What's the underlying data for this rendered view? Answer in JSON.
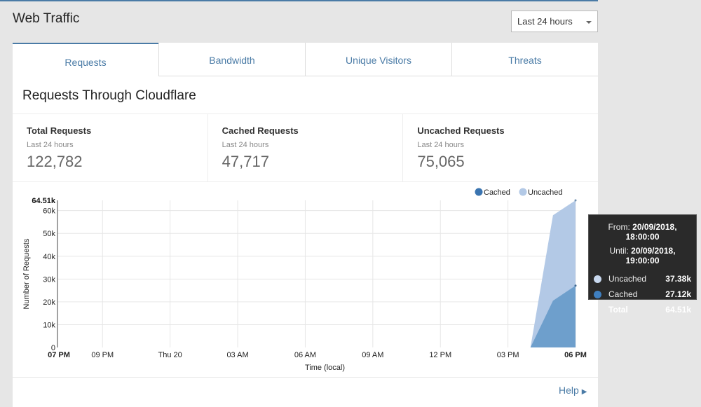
{
  "header": {
    "title": "Web Traffic",
    "range_select": "Last 24 hours"
  },
  "tabs": [
    {
      "label": "Requests"
    },
    {
      "label": "Bandwidth"
    },
    {
      "label": "Unique Visitors"
    },
    {
      "label": "Threats"
    }
  ],
  "section_title": "Requests Through Cloudflare",
  "stats": [
    {
      "label": "Total Requests",
      "sub": "Last 24 hours",
      "value": "122,782"
    },
    {
      "label": "Cached Requests",
      "sub": "Last 24 hours",
      "value": "47,717"
    },
    {
      "label": "Uncached Requests",
      "sub": "Last 24 hours",
      "value": "75,065"
    }
  ],
  "tooltip": {
    "from_label": "From:",
    "from": "20/09/2018, 18:00:00",
    "until_label": "Until:",
    "until": "20/09/2018, 19:00:00",
    "rows": [
      {
        "name": "Uncached",
        "value": "37.38k"
      },
      {
        "name": "Cached",
        "value": "27.12k"
      },
      {
        "name": "Total",
        "value": "64.51k"
      }
    ]
  },
  "help": "Help",
  "colors": {
    "cached": "#4a86c0",
    "uncached": "#b0c8e6",
    "accent": "#4a7ba6"
  },
  "chart_data": {
    "type": "area",
    "stacked": true,
    "xlabel": "Time (local)",
    "ylabel": "Number of Requests",
    "x_hours": [
      0,
      1,
      2,
      3,
      4,
      5,
      6,
      7,
      8,
      9,
      10,
      11,
      12,
      13,
      14,
      15,
      16,
      17,
      18,
      19,
      20,
      21,
      22,
      23
    ],
    "x_ticks": [
      {
        "h": 0,
        "label": "07 PM"
      },
      {
        "h": 2,
        "label": "09 PM"
      },
      {
        "h": 5,
        "label": "Thu 20"
      },
      {
        "h": 8,
        "label": "03 AM"
      },
      {
        "h": 11,
        "label": "06 AM"
      },
      {
        "h": 14,
        "label": "09 AM"
      },
      {
        "h": 17,
        "label": "12 PM"
      },
      {
        "h": 20,
        "label": "03 PM"
      },
      {
        "h": 23,
        "label": "06 PM"
      }
    ],
    "y_ticks": [
      {
        "v": 0,
        "label": "0"
      },
      {
        "v": 10,
        "label": "10k"
      },
      {
        "v": 20,
        "label": "20k"
      },
      {
        "v": 30,
        "label": "30k"
      },
      {
        "v": 40,
        "label": "40k"
      },
      {
        "v": 50,
        "label": "50k"
      },
      {
        "v": 60,
        "label": "60k"
      }
    ],
    "y_max_label": "64.51k",
    "ylim": [
      0,
      64.51
    ],
    "legend": [
      "Cached",
      "Uncached"
    ],
    "legend_position": "top-right",
    "series": [
      {
        "name": "Cached",
        "values": [
          0,
          0,
          0,
          0,
          0,
          0,
          0,
          0,
          0,
          0,
          0,
          0,
          0,
          0,
          0,
          0,
          0,
          0,
          0,
          0,
          0,
          0,
          20.5,
          27.12
        ]
      },
      {
        "name": "Uncached",
        "values": [
          0,
          0,
          0,
          0,
          0,
          0,
          0,
          0,
          0,
          0,
          0,
          0,
          0,
          0,
          0,
          0,
          0,
          0,
          0,
          0,
          0,
          0,
          37.5,
          37.39
        ]
      }
    ]
  }
}
